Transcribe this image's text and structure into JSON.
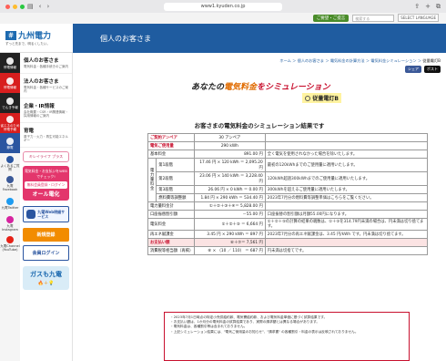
{
  "browser": {
    "url": "www1.kyuden.co.jp",
    "traffic_colors": [
      "#ff5f57",
      "#febc2e",
      "#28c840"
    ]
  },
  "top_bar": {
    "chip_label": "ご要望・ご提言",
    "search_placeholder": "検索する",
    "lang_label": "SELECT LANGUAGE"
  },
  "logo": {
    "name": "九州電力",
    "tagline": "ずっと先まで、明るくしたい。"
  },
  "icon_rail": [
    {
      "label": "停電情報",
      "icon": "outage-icon"
    },
    {
      "label": "停電情報",
      "icon": "alert-icon"
    },
    {
      "label": "でんき予報",
      "icon": "forecast-icon"
    },
    {
      "label": "省エネのため停電予報",
      "icon": "schedule-icon"
    },
    {
      "label": "節電",
      "icon": "saving-icon"
    },
    {
      "label": "よくあるご質問",
      "icon": "faq-icon"
    },
    {
      "label": "九電Facebook",
      "icon": "facebook-icon"
    },
    {
      "label": "九電Twitter",
      "icon": "twitter-icon"
    },
    {
      "label": "九電Instagram",
      "icon": "instagram-icon"
    },
    {
      "label": "九電Channel (YouTube)",
      "icon": "youtube-icon"
    }
  ],
  "side_nav": [
    {
      "title": "個人のお客さま",
      "sub": "電気料金・各種手続きのご案内"
    },
    {
      "title": "法人のお客さま",
      "sub": "電気料金・各種サービスのご案内"
    },
    {
      "title": "企業・IR情報",
      "sub": "会社概要・CSR・IR関連情報・採用情報のご案内"
    },
    {
      "title": "育電",
      "sub": "原子力・火力・再生可能エネルギー"
    }
  ],
  "banners": {
    "pink_label": "キレイライフ プラス",
    "card_line1": "電気料金・お支払いをWEBでチェック!",
    "card_line2": "無料会員登録・ログイン",
    "card_line3": "オール電化",
    "blue_label": "九電Web明細サービス",
    "orange_button": "新規登録",
    "login_button": "会員ログイン",
    "gas_label": "ガスも九電"
  },
  "main": {
    "section_title": "個人のお客さま",
    "breadcrumb": [
      "ホーム",
      "個人のお客さま",
      "電気料金の計算方法",
      "電気料金シミュレーション"
    ],
    "breadcrumb_current": "従量電灯B",
    "share_fb": "シェア",
    "share_x": "ポスト",
    "title_lead_1": "あなたの",
    "title_lead_2": "電気料金",
    "title_lead_3": "をシミュレーション",
    "plan_name": "従量電灯B",
    "result_heading": "お客さまの電気料金のシミュレーション結果です"
  },
  "results": {
    "contract": {
      "label": "ご契約アンペア",
      "value": "30 アンペア"
    },
    "usage": {
      "label": "電気ご使用量",
      "value": "290 kWh"
    },
    "basic": {
      "label": "基本料金",
      "value": "891.00 円",
      "note": "全く電気を使用されなかった場合を除いたします。"
    },
    "energy_label": "電力量料金",
    "tiers": [
      {
        "name": "第1段階",
        "calc": "17.46 円 × 120 kWh ＝ 2,095.20 円",
        "note": "最初の120kWhまでのご使用量に適用いたします。"
      },
      {
        "name": "第2段階",
        "calc": "23.06 円 × 140 kWh ＝ 3,228.40 円",
        "note": "120kWh超過300kWhまでのご使用量に適用いたします。"
      },
      {
        "name": "第3段階",
        "calc": "26.06 円 × 0 kWh ＝ 0.00 円",
        "note": "300kWhを超えるご使用量に適用いたします。"
      },
      {
        "name": "燃料費等調整額",
        "calc": "1.84 円 × 290 kWh ＝ 534.40 円",
        "note": "2023年7月分の燃料費等調整単価はこちらをご覧ください。"
      }
    ],
    "energy_total": {
      "label": "電力量料金計",
      "value": "①＋②＋③＋④＝ 5,828.00 円"
    },
    "discount": {
      "label": "口座振替割引額",
      "value": "－55.00 円",
      "note": "口座振替の割引額は月額55.00円になります。"
    },
    "subtotal": {
      "label": "電気料金",
      "value": "①＋②＋⑤ ＝ 6,664 円",
      "note": "①＋②＋⑤の計算の結果の端数は、①＋⑤を314.79円未満の場合は、円未満は切り捨てます。"
    },
    "renewable": {
      "label": "再エネ賦課金",
      "value": "3.45 円 × 290 kWh ＝ 897 円",
      "note": "2023年7月分の再エネ賦課金は、3.45 円/kWh です。円未満は切り捨てます。"
    },
    "total": {
      "label": "お支払い額",
      "value": "⑥＋⑦＝ 7,561 円"
    },
    "tax": {
      "label": "消費税等相当額（再掲）",
      "value": "⑧ × （10 ／ 110） ＝ 687 円",
      "note": "円未満は切捨てです。"
    }
  },
  "notes": [
    "2023年7月1日時点の特定小売供給約款、電気需給約款、および電気料金単価に基づく試算結果です。",
    "お支払い額は、1か月分の電気料金の試算結果であり、実際の請求額とは異なる場合があります。",
    "電気料金は、各種割引等は含まれておりません。",
    "上記シミュレーション結果には、\"電気ご使用量のお知らせ\"、\"請求書\" の各種割引・料金の表示は反映されておりません。"
  ],
  "colors": {
    "brand_blue": "#1f5ca0",
    "alert_red": "#c8102e",
    "accent_orange": "#f28c00"
  }
}
